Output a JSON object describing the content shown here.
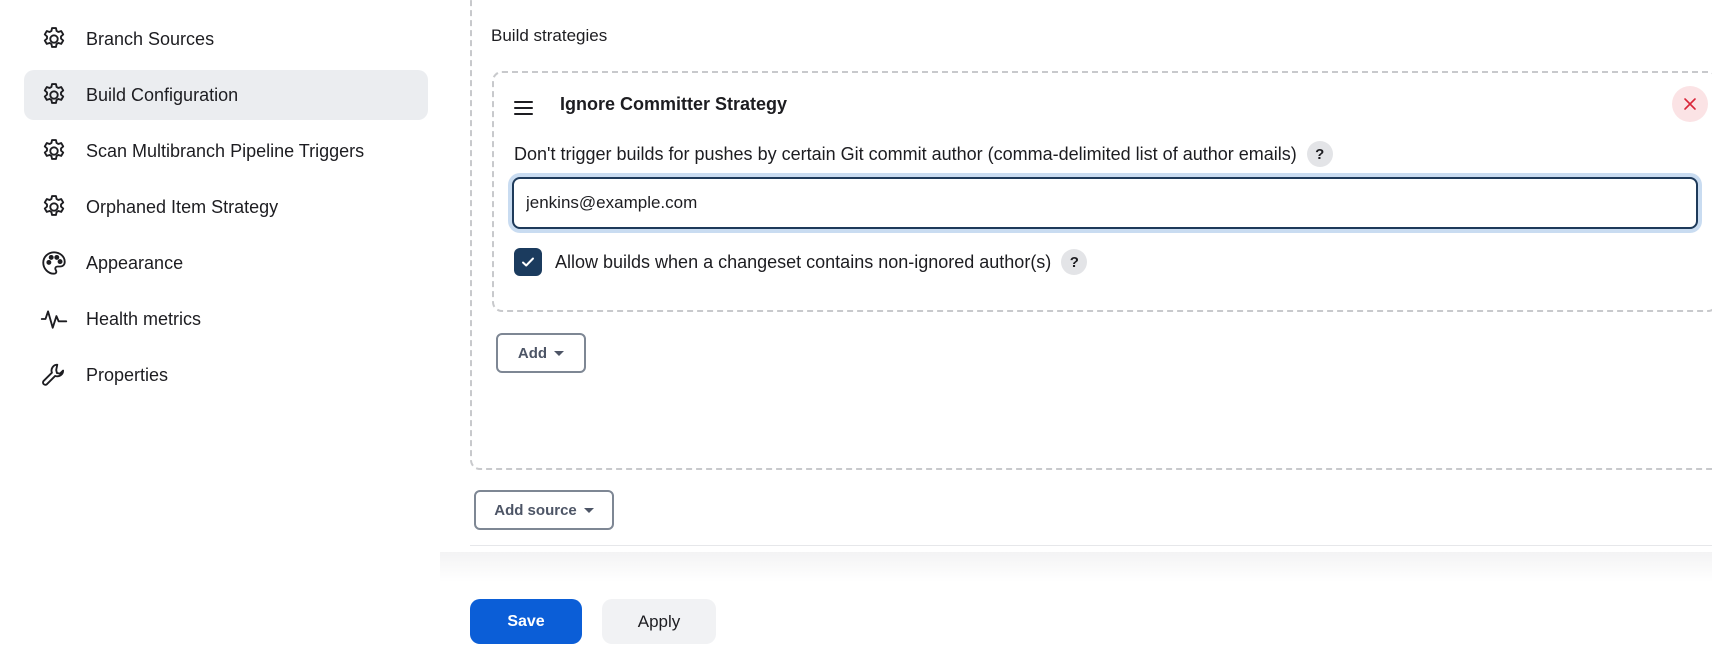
{
  "sidebar": {
    "items": [
      {
        "label": "Branch Sources",
        "icon": "gear-icon",
        "active": false
      },
      {
        "label": "Build Configuration",
        "icon": "gear-icon",
        "active": true
      },
      {
        "label": "Scan Multibranch Pipeline Triggers",
        "icon": "gear-icon",
        "active": false
      },
      {
        "label": "Orphaned Item Strategy",
        "icon": "gear-icon",
        "active": false
      },
      {
        "label": "Appearance",
        "icon": "palette-icon",
        "active": false
      },
      {
        "label": "Health metrics",
        "icon": "pulse-icon",
        "active": false
      },
      {
        "label": "Properties",
        "icon": "wrench-icon",
        "active": false
      }
    ]
  },
  "main": {
    "section_title": "Build strategies",
    "strategy": {
      "title": "Ignore Committer Strategy",
      "field_label": "Don't trigger builds for pushes by certain Git commit author (comma-delimited list of author emails)",
      "field_value": "jenkins@example.com",
      "help_glyph": "?",
      "checkbox_label": "Allow builds when a changeset contains non-ignored author(s)",
      "checkbox_checked": true
    },
    "add_label": "Add",
    "add_source_label": "Add source"
  },
  "footer": {
    "save_label": "Save",
    "apply_label": "Apply"
  },
  "colors": {
    "primary": "#0b5ed7",
    "checkbox": "#1b3b5e",
    "danger": "#d9263a",
    "active_bg": "#ebedf0"
  }
}
